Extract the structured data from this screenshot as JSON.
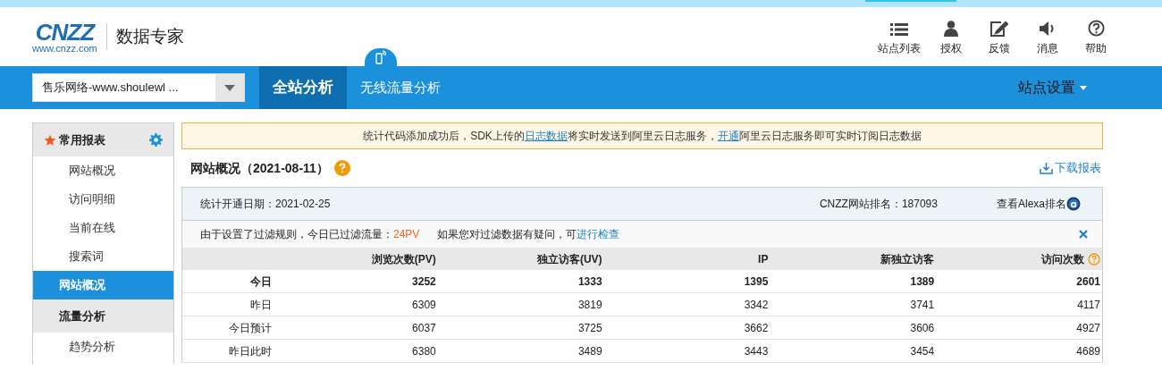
{
  "logo": {
    "brand": "CNZZ",
    "url": "www.cnzz.com",
    "product": "数据专家"
  },
  "top_actions": [
    {
      "kind": "list",
      "label": "站点列表"
    },
    {
      "kind": "person",
      "label": "授权"
    },
    {
      "kind": "edit",
      "label": "反馈"
    },
    {
      "kind": "sound",
      "label": "消息"
    },
    {
      "kind": "help",
      "label": "帮助"
    }
  ],
  "site_select": {
    "value": "售乐网络-www.shoulewl ..."
  },
  "nav_tabs": [
    {
      "label": "全站分析",
      "selected": true,
      "mobile_badge": false
    },
    {
      "label": "无线流量分析",
      "selected": false,
      "mobile_badge": true
    }
  ],
  "site_settings": "站点设置",
  "sidebar": [
    {
      "kind": "group",
      "label": "常用报表",
      "starred": true,
      "settings": true
    },
    {
      "kind": "item",
      "label": "网站概况",
      "selected": false
    },
    {
      "kind": "item",
      "label": "访问明细",
      "selected": false
    },
    {
      "kind": "item",
      "label": "当前在线",
      "selected": false
    },
    {
      "kind": "item",
      "label": "搜索词",
      "selected": false
    },
    {
      "kind": "item",
      "label": "网站概况",
      "selected": true
    },
    {
      "kind": "group",
      "label": "流量分析",
      "starred": false,
      "settings": false
    },
    {
      "kind": "item",
      "label": "趋势分析",
      "selected": false
    }
  ],
  "notice": [
    {
      "kind": "text",
      "text": "统计代码添加成功后，SDK上传的"
    },
    {
      "kind": "link",
      "text": "日志数据"
    },
    {
      "kind": "text",
      "text": "将实时发送到阿里云日志服务，"
    },
    {
      "kind": "link",
      "text": "开通"
    },
    {
      "kind": "text",
      "text": "阿里云日志服务即可实时订阅日志数据"
    }
  ],
  "page_title": "网站概况（2021-08-11）",
  "download": "下载报表",
  "summary": {
    "start_date": "统计开通日期：2021-02-25",
    "rank": "CNZZ网站排名：187093",
    "alexa": "查看Alexa排名"
  },
  "filter_note": {
    "text": "由于设置了过滤规则，今日已过滤流量：",
    "value": "24PV",
    "question": "如果您对过滤数据有疑问，可",
    "link": "进行检查"
  },
  "table": {
    "columns": [
      {
        "label": "浏览次数(PV)",
        "help": false
      },
      {
        "label": "独立访客(UV)",
        "help": false
      },
      {
        "label": "IP",
        "help": false
      },
      {
        "label": "新独立访客",
        "help": false
      },
      {
        "label": "访问次数",
        "help": true
      }
    ],
    "rows": [
      {
        "label": "今日",
        "bold": true,
        "cells": [
          "3252",
          "1333",
          "1395",
          "1389",
          "2601"
        ]
      },
      {
        "label": "昨日",
        "bold": false,
        "cells": [
          "6309",
          "3819",
          "3342",
          "3741",
          "4117"
        ]
      },
      {
        "label": "今日预计",
        "bold": false,
        "cells": [
          "6037",
          "3725",
          "3662",
          "3606",
          "4927"
        ]
      },
      {
        "label": "昨日此时",
        "bold": false,
        "cells": [
          "6380",
          "3489",
          "3443",
          "3454",
          "4689"
        ]
      }
    ]
  }
}
